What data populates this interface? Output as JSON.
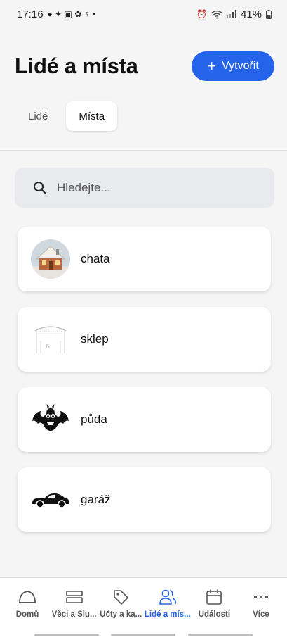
{
  "status_bar": {
    "time": "17:16",
    "battery": "41%"
  },
  "header": {
    "title": "Lidé a místa",
    "create_label": "Vytvořit"
  },
  "tabs": [
    {
      "label": "Lidé",
      "active": false
    },
    {
      "label": "Místa",
      "active": true
    }
  ],
  "search": {
    "placeholder": "Hledejte..."
  },
  "places": [
    {
      "name": "chata",
      "icon": "cottage-photo"
    },
    {
      "name": "sklep",
      "icon": "cellar-sketch"
    },
    {
      "name": "půda",
      "icon": "bat-icon"
    },
    {
      "name": "garáž",
      "icon": "car-icon"
    }
  ],
  "bottom_nav": [
    {
      "label": "Domů",
      "icon": "home-icon"
    },
    {
      "label": "Věci a Slu...",
      "icon": "box-icon"
    },
    {
      "label": "Účty a ka...",
      "icon": "tag-icon"
    },
    {
      "label": "Lidé a mís...",
      "icon": "people-icon",
      "active": true
    },
    {
      "label": "Události",
      "icon": "calendar-icon"
    },
    {
      "label": "Více",
      "icon": "more-icon"
    }
  ],
  "colors": {
    "accent": "#2563eb",
    "background": "#f5f5f6",
    "card": "#ffffff",
    "search_bg": "#e9eaee"
  }
}
